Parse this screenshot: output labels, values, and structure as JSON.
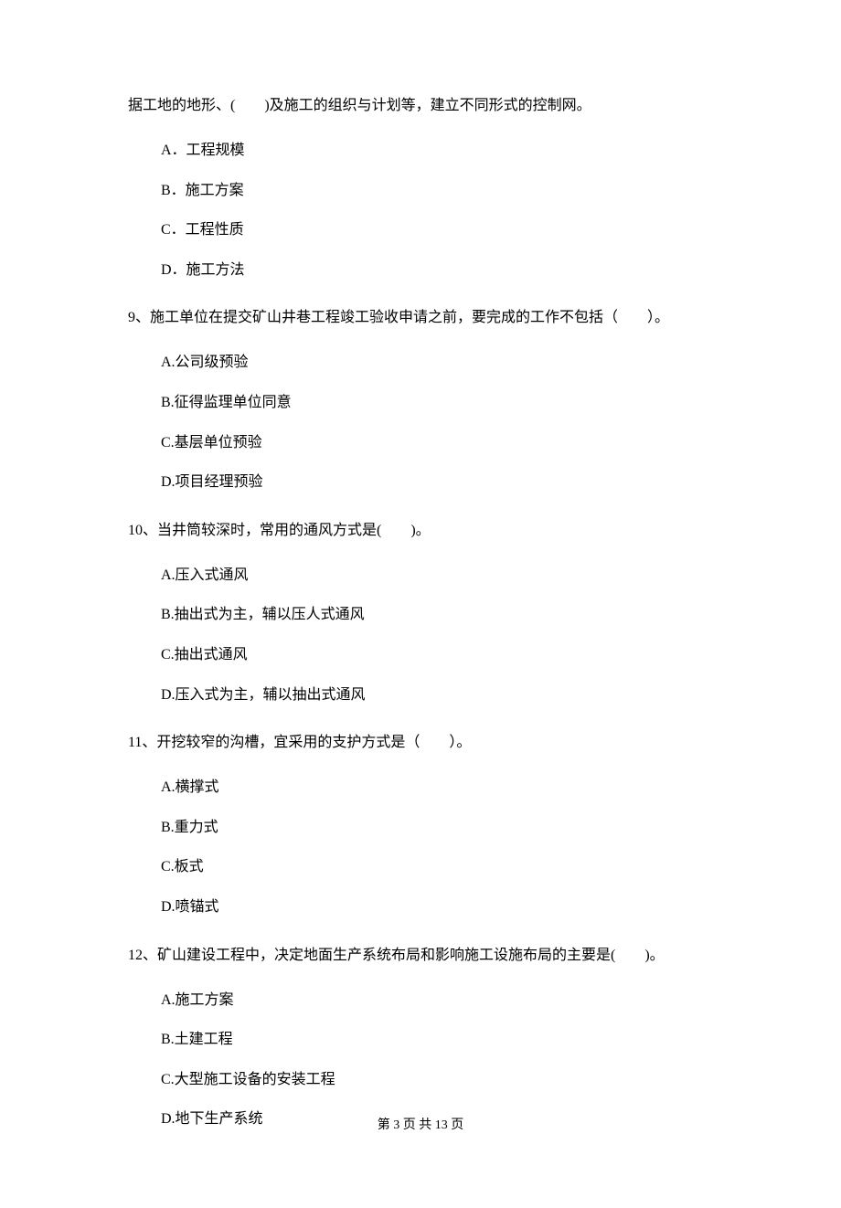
{
  "continuation": "据工地的地形、(　　)及施工的组织与计划等，建立不同形式的控制网。",
  "q8_options": {
    "a": "A．工程规模",
    "b": "B．施工方案",
    "c": "C．工程性质",
    "d": "D．施工方法"
  },
  "q9": {
    "stem": "9、施工单位在提交矿山井巷工程竣工验收申请之前，要完成的工作不包括（　　）。",
    "a": "A.公司级预验",
    "b": "B.征得监理单位同意",
    "c": "C.基层单位预验",
    "d": "D.项目经理预验"
  },
  "q10": {
    "stem": "10、当井筒较深时，常用的通风方式是(　　)。",
    "a": "A.压入式通风",
    "b": "B.抽出式为主，辅以压人式通风",
    "c": "C.抽出式通风",
    "d": "D.压入式为主，辅以抽出式通风"
  },
  "q11": {
    "stem": "11、开挖较窄的沟槽，宜采用的支护方式是（　　）。",
    "a": "A.横撑式",
    "b": "B.重力式",
    "c": "C.板式",
    "d": "D.喷锚式"
  },
  "q12": {
    "stem": "12、矿山建设工程中，决定地面生产系统布局和影响施工设施布局的主要是(　　)。",
    "a": "A.施工方案",
    "b": "B.土建工程",
    "c": "C.大型施工设备的安装工程",
    "d": "D.地下生产系统"
  },
  "footer": "第 3 页 共 13 页"
}
